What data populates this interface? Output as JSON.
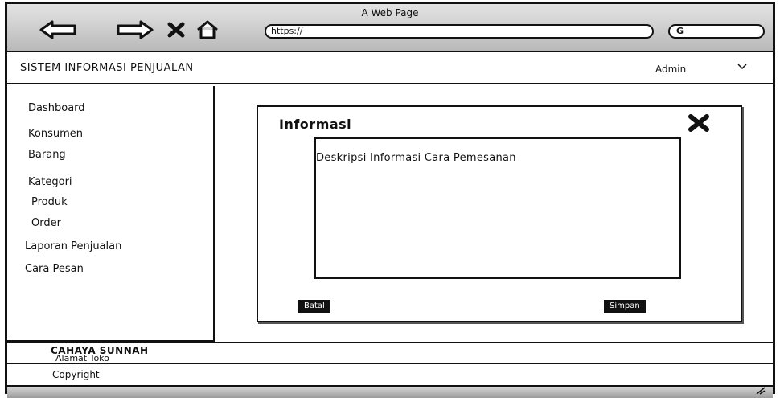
{
  "browser": {
    "window_title": "A Web Page",
    "url_value": "https://",
    "search_value": "G"
  },
  "header": {
    "app_title": "SISTEM INFORMASI PENJUALAN",
    "user": "Admin"
  },
  "sidebar": {
    "items": [
      {
        "label": "Dashboard"
      },
      {
        "label": "Konsumen"
      },
      {
        "label": "Barang"
      },
      {
        "label": "Kategori"
      },
      {
        "label": "Produk"
      },
      {
        "label": "Order"
      },
      {
        "label": "Laporan Penjualan"
      },
      {
        "label": "Cara Pesan"
      }
    ]
  },
  "dialog": {
    "title": "Informasi",
    "body_text": "Deskripsi Informasi Cara Pemesanan",
    "left_button": "Batal",
    "right_button": "Simpan"
  },
  "footer": {
    "shop_name": "CAHAYA SUNNAH",
    "address": "Alamat Toko",
    "copyright": "Copyright"
  },
  "icons": {
    "back": "arrow-left-icon",
    "forward": "arrow-right-icon",
    "stop": "close-icon",
    "home": "home-icon",
    "dropdown": "chevron-down-icon",
    "dialog_close": "close-icon"
  }
}
